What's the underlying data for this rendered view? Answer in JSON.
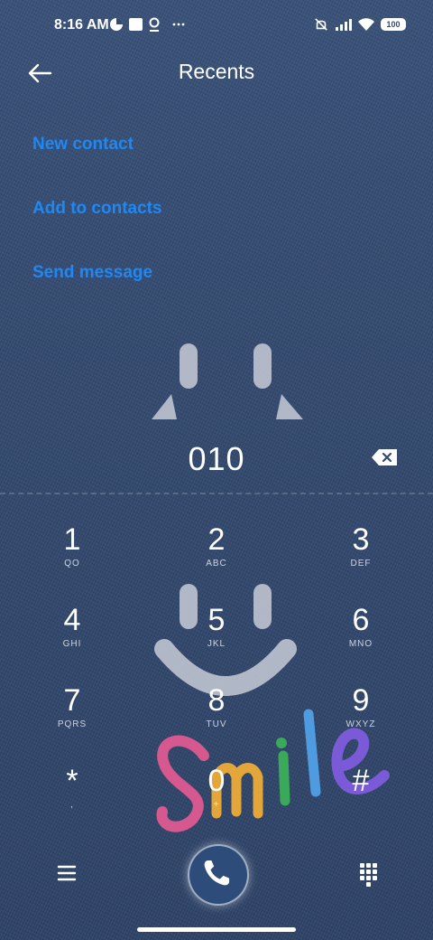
{
  "status_bar": {
    "time": "8:16 AM",
    "battery": "100",
    "icons": [
      "data-saver-icon",
      "notification-square-icon",
      "location-pin-icon",
      "more-dots-icon",
      "vibrate-muted-icon",
      "signal-icon",
      "wifi-icon",
      "battery-icon"
    ]
  },
  "header": {
    "title": "Recents",
    "back_icon": "back-arrow-icon"
  },
  "actions": {
    "new_contact": "New contact",
    "add_to_contacts": "Add to contacts",
    "send_message": "Send message",
    "link_color": "#1e88f5"
  },
  "dialer": {
    "number": "010",
    "backspace_icon": "backspace-icon"
  },
  "keypad": [
    {
      "digit": "1",
      "letters": "QO"
    },
    {
      "digit": "2",
      "letters": "ABC"
    },
    {
      "digit": "3",
      "letters": "DEF"
    },
    {
      "digit": "4",
      "letters": "GHI"
    },
    {
      "digit": "5",
      "letters": "JKL"
    },
    {
      "digit": "6",
      "letters": "MNO"
    },
    {
      "digit": "7",
      "letters": "PQRS"
    },
    {
      "digit": "8",
      "letters": "TUV"
    },
    {
      "digit": "9",
      "letters": "WXYZ"
    },
    {
      "digit": "*",
      "letters": ","
    },
    {
      "digit": "0",
      "letters": "+"
    },
    {
      "digit": "#",
      "letters": ""
    }
  ],
  "bottom_bar": {
    "menu_icon": "menu-icon",
    "call_icon": "phone-call-icon",
    "dialpad_icon": "dialpad-icon"
  },
  "wallpaper": {
    "text": "Smile",
    "colors": [
      "#d94f8a",
      "#e3a63a",
      "#3aa95a",
      "#4f7fe0",
      "#7a5ad6"
    ]
  }
}
